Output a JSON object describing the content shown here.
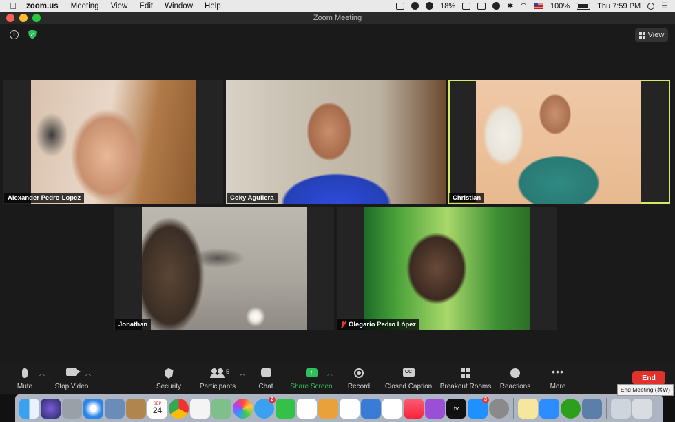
{
  "menubar": {
    "app_name": "zoom.us",
    "items": [
      "Meeting",
      "View",
      "Edit",
      "Window",
      "Help"
    ],
    "battery_small": "18%",
    "battery_main": "100%",
    "clock": "Thu 7:59 PM"
  },
  "window": {
    "title": "Zoom Meeting",
    "view_label": "View"
  },
  "participants": [
    {
      "name": "Alexander Pedro-Lopez",
      "muted": false
    },
    {
      "name": "Coky Aguilera",
      "muted": false
    },
    {
      "name": "Christian",
      "muted": false,
      "active_speaker": true
    },
    {
      "name": "Jonathan",
      "muted": false
    },
    {
      "name": "Olegario Pedro López",
      "muted": true
    }
  ],
  "toolbar": {
    "mute": "Mute",
    "stop_video": "Stop Video",
    "security": "Security",
    "participants": "Participants",
    "participants_count": "5",
    "chat": "Chat",
    "share_screen": "Share Screen",
    "record": "Record",
    "closed_caption": "Closed Caption",
    "cc_icon_text": "CC",
    "breakout_rooms": "Breakout Rooms",
    "reactions": "Reactions",
    "more": "More",
    "end": "End",
    "end_tooltip": "End Meeting (⌘W)"
  },
  "dock": {
    "calendar_month": "SEP",
    "calendar_day": "24",
    "messages_badge": "2",
    "appstore_badge": "3"
  },
  "colors": {
    "active_speaker_border": "#d7e766",
    "end_button": "#e0312b",
    "share_green": "#2fbf5b"
  }
}
